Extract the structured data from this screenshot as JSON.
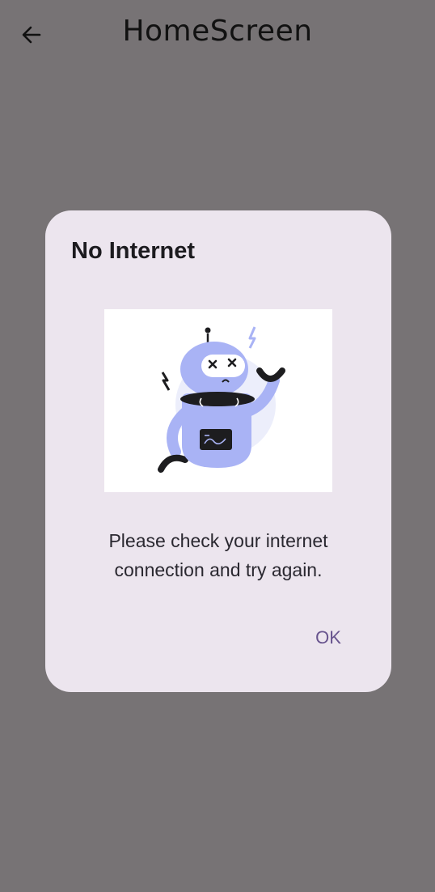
{
  "app_bar": {
    "title": "HomeScreen",
    "back_icon": "arrow-left-icon"
  },
  "dialog": {
    "title": "No Internet",
    "illustration": "broken-robot-illustration",
    "message": "Please check your internet connection and try again.",
    "ok_label": "OK"
  },
  "colors": {
    "scrim": "#777375",
    "dialog_surface": "#ece5ee",
    "accent": "#68548e",
    "robot_body": "#a9b3f5"
  }
}
